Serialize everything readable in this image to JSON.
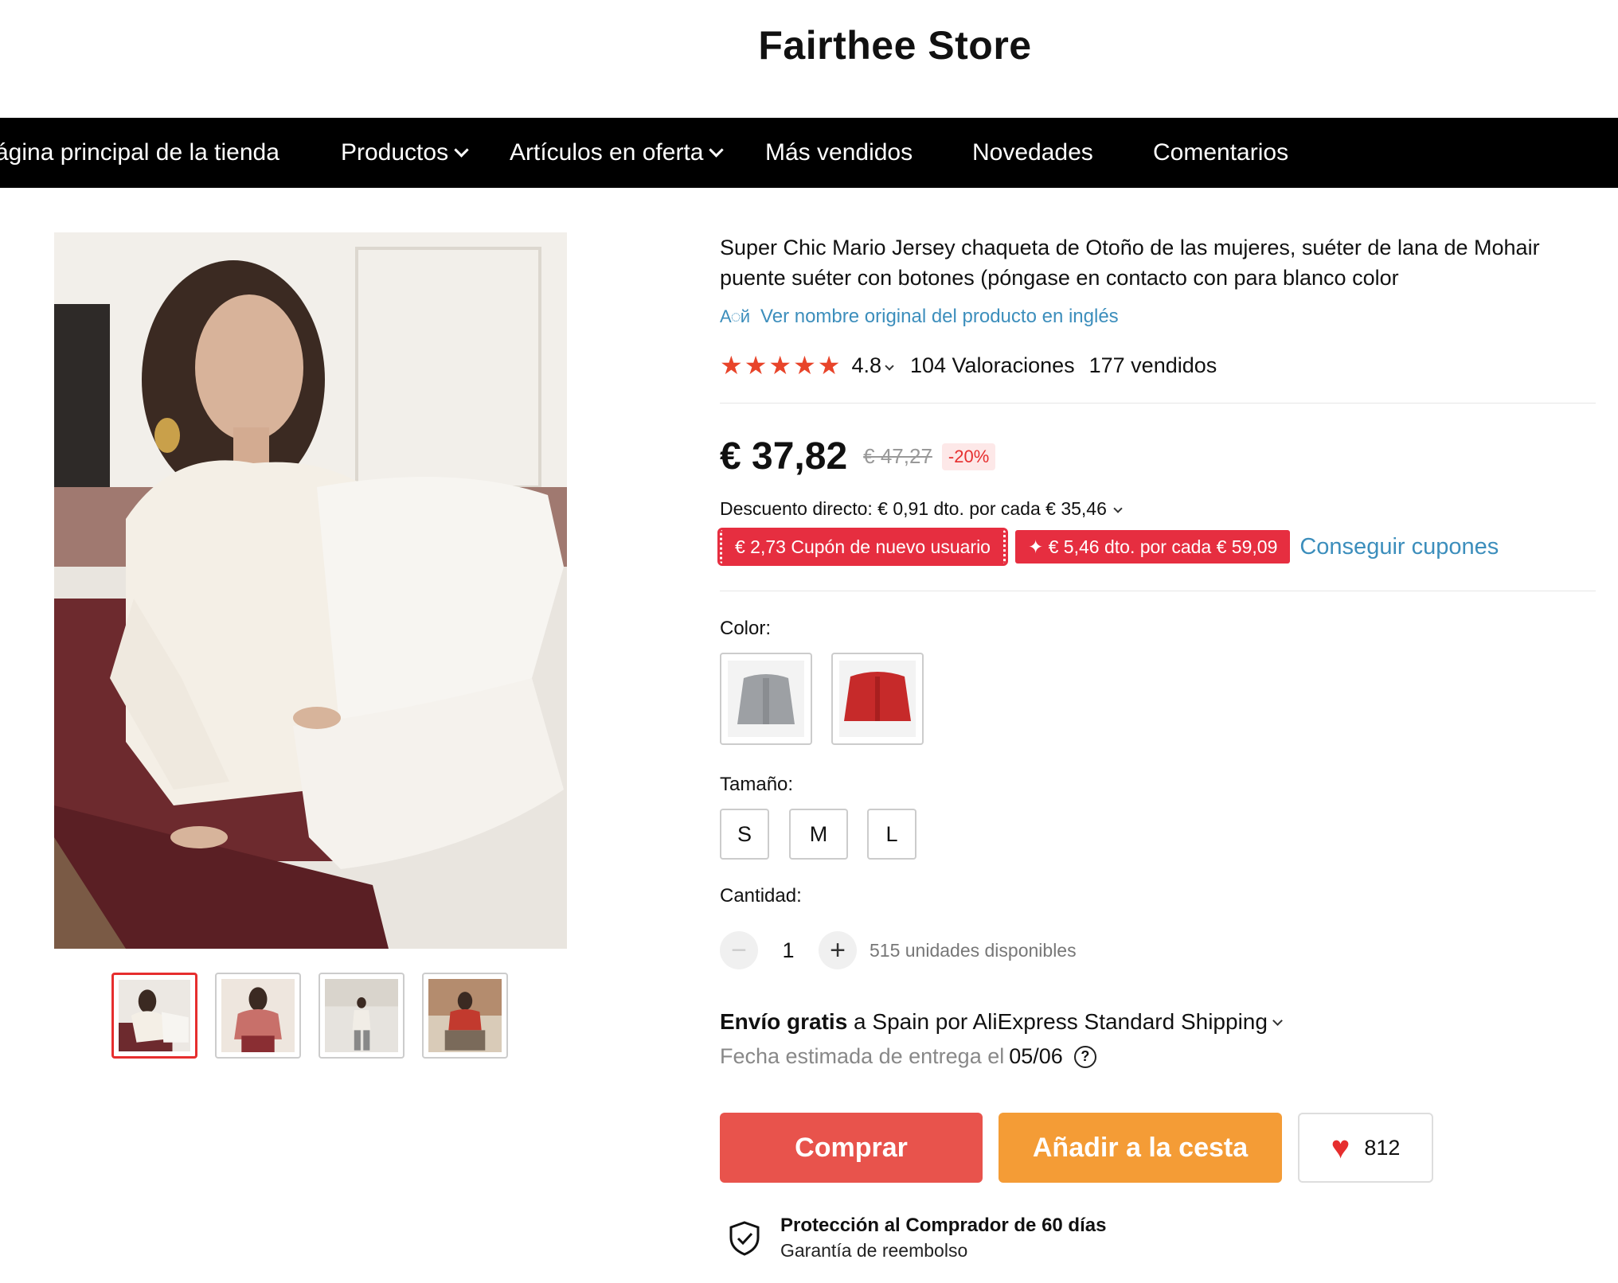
{
  "store": {
    "title": "Fairthee Store"
  },
  "nav": {
    "items": [
      {
        "label": "ágina principal de la tienda",
        "has_dropdown": false
      },
      {
        "label": "Productos",
        "has_dropdown": true
      },
      {
        "label": "Artículos en oferta",
        "has_dropdown": true
      },
      {
        "label": "Más vendidos",
        "has_dropdown": false
      },
      {
        "label": "Novedades",
        "has_dropdown": false
      },
      {
        "label": "Comentarios",
        "has_dropdown": false
      }
    ]
  },
  "product": {
    "title": "Super Chic Mario Jersey chaqueta de Otoño de las mujeres, suéter de lana de Mohair puente suéter con botones (póngase en contacto con para blanco color",
    "translate_link": "Ver nombre original del producto en inglés",
    "rating": "4.8",
    "reviews": "104 Valoraciones",
    "sold": "177 vendidos",
    "price": "€ 37,82",
    "old_price": "€ 47,27",
    "discount": "-20%",
    "direct_discount": "Descuento directo: € 0,91 dto. por cada € 35,46",
    "coupons": [
      "€ 2,73 Cupón de nuevo usuario",
      "✦ € 5,46 dto. por cada € 59,09"
    ],
    "get_coupons": "Conseguir cupones",
    "color_label": "Color:",
    "size_label": "Tamaño:",
    "sizes": [
      "S",
      "M",
      "L"
    ],
    "quantity_label": "Cantidad:",
    "quantity": "1",
    "available": "515 unidades disponibles",
    "shipping_bold": "Envío gratis",
    "shipping_rest": " a Spain por AliExpress Standard Shipping",
    "delivery_label": "Fecha estimada de entrega el",
    "delivery_date": "05/06",
    "buy_label": "Comprar",
    "cart_label": "Añadir a la cesta",
    "wishlist_count": "812",
    "protection_title": "Protección al Comprador de 60 días",
    "protection_sub": "Garantía de reembolso"
  },
  "colors": {
    "accent_red": "#e8534c",
    "accent_orange": "#f49c36",
    "link_blue": "#3c8ebc",
    "star": "#e8442a"
  }
}
